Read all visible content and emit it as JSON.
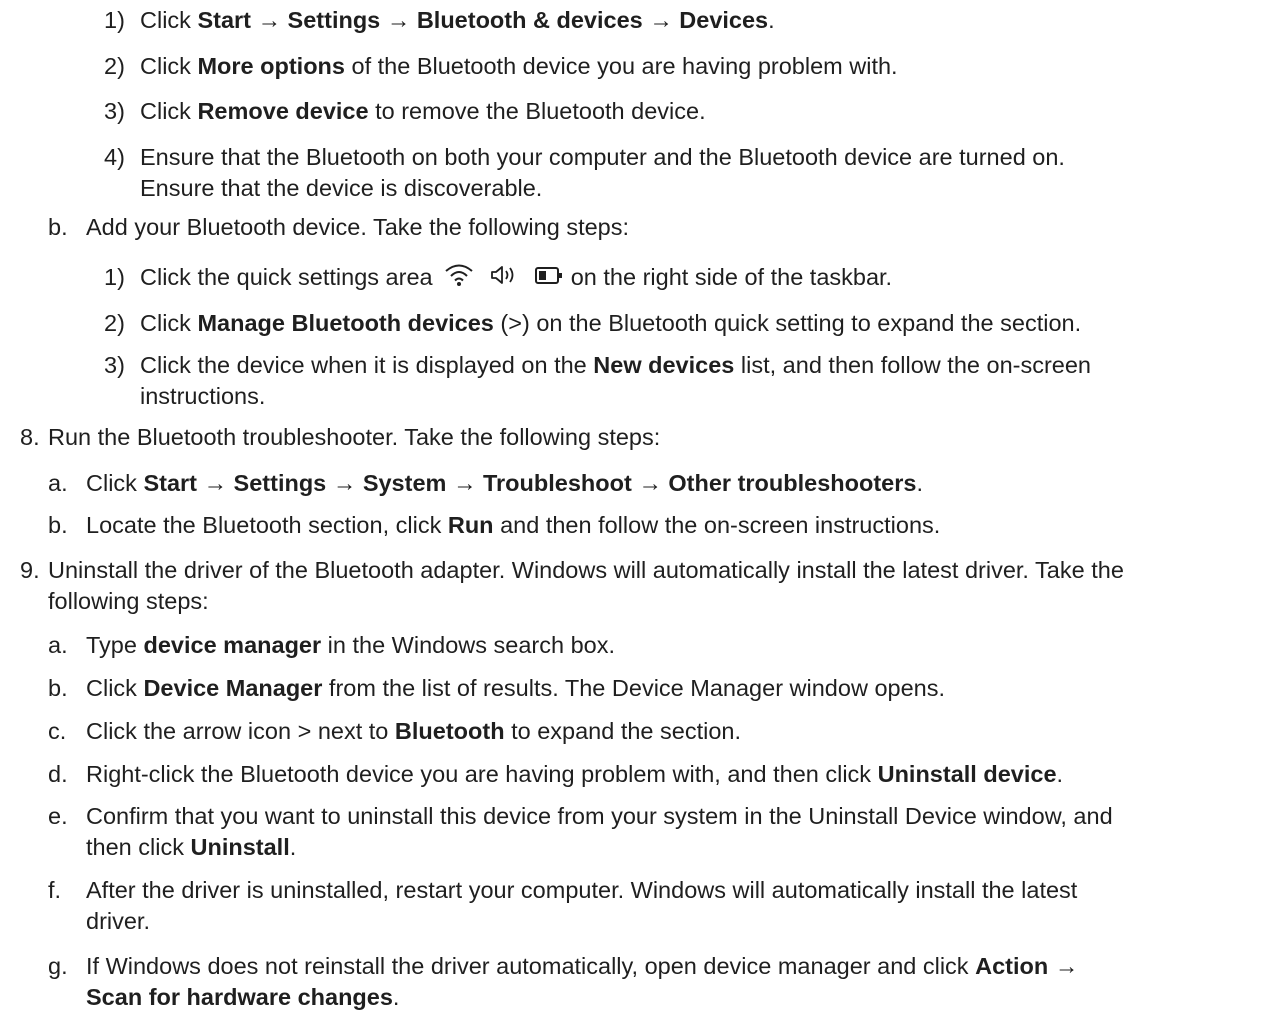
{
  "steps": {
    "a1": {
      "marker": "1)",
      "p1": "Click ",
      "b1": "Start → Settings → Bluetooth & devices → Devices",
      "p2": "."
    },
    "a2": {
      "marker": "2)",
      "p1": "Click ",
      "b1": "More options",
      "p2": " of the Bluetooth device you are having problem with."
    },
    "a3": {
      "marker": "3)",
      "p1": "Click ",
      "b1": "Remove device",
      "p2": " to remove the Bluetooth device."
    },
    "a4": {
      "marker": "4)",
      "l1": "Ensure that the Bluetooth on both your computer and the Bluetooth device are turned on.",
      "l2": "Ensure that the device is discoverable."
    },
    "b": {
      "marker": "b.",
      "text": "Add your Bluetooth device. Take the following steps:"
    },
    "b1": {
      "marker": "1)",
      "p1": "Click the quick settings area",
      "p2": "on the right side of the taskbar.",
      "icons": [
        "wifi-icon",
        "volume-icon",
        "battery-icon"
      ]
    },
    "b2": {
      "marker": "2)",
      "p1": "Click ",
      "b1": "Manage Bluetooth devices",
      "p2": " (>) on the Bluetooth quick setting to expand the section."
    },
    "b3": {
      "marker": "3)",
      "p1": "Click the device when it is displayed on the ",
      "b1": "New devices",
      "p2": " list, and then follow the on-screen",
      "l2": "instructions."
    },
    "s8": {
      "marker": "8.",
      "text": "Run the Bluetooth troubleshooter. Take the following steps:"
    },
    "s8a": {
      "marker": "a.",
      "p1": "Click ",
      "b1": "Start → Settings → System → Troubleshoot → Other troubleshooters",
      "p2": "."
    },
    "s8b": {
      "marker": "b.",
      "p1": "Locate the Bluetooth section, click ",
      "b1": "Run",
      "p2": " and then follow the on-screen instructions."
    },
    "s9": {
      "marker": "9.",
      "l1": "Uninstall the driver of the Bluetooth adapter. Windows will automatically install the latest driver. Take the",
      "l2": "following steps:"
    },
    "s9a": {
      "marker": "a.",
      "p1": "Type ",
      "b1": "device manager",
      "p2": " in the Windows search box."
    },
    "s9b": {
      "marker": "b.",
      "p1": "Click ",
      "b1": "Device Manager",
      "p2": " from the list of results. The Device Manager window opens."
    },
    "s9c": {
      "marker": "c.",
      "p1": "Click the arrow icon > next to ",
      "b1": "Bluetooth",
      "p2": " to expand the section."
    },
    "s9d": {
      "marker": "d.",
      "p1": "Right-click the Bluetooth device you are having problem with, and then click ",
      "b1": "Uninstall device",
      "p2": "."
    },
    "s9e": {
      "marker": "e.",
      "l1": "Confirm that you want to uninstall this device from your system in the Uninstall Device window, and",
      "l2p1": "then click ",
      "l2b1": "Uninstall",
      "l2p2": "."
    },
    "s9f": {
      "marker": "f.",
      "l1": "After the driver is uninstalled, restart your computer. Windows will automatically install the latest",
      "l2": "driver."
    },
    "s9g": {
      "marker": "g.",
      "p1": "If Windows does not reinstall the driver automatically, open device manager and click ",
      "b1": "Action →",
      "l2b1": "Scan for hardware changes",
      "l2p2": "."
    }
  }
}
